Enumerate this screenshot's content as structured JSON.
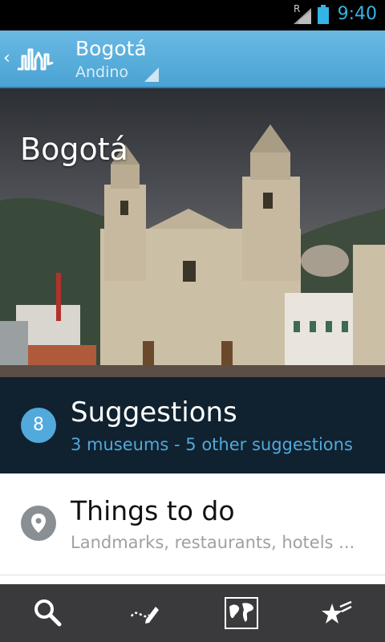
{
  "status_bar": {
    "time": "9:40",
    "network_letter": "R"
  },
  "action_bar": {
    "title": "Bogotá",
    "subtitle": "Andino"
  },
  "hero": {
    "title": "Bogotá"
  },
  "suggestions": {
    "count": "8",
    "title": "Suggestions",
    "subtitle": "3 museums - 5 other suggestions"
  },
  "things_to_do": {
    "title": "Things to do",
    "subtitle": "Landmarks, restaurants, hotels ..."
  },
  "bottom_tabs": [
    {
      "icon": "search-icon"
    },
    {
      "icon": "route-pencil-icon"
    },
    {
      "icon": "map-icon"
    },
    {
      "icon": "stars-icon"
    }
  ],
  "colors": {
    "accent": "#52a9db",
    "action_bar": "#5aaedc",
    "dark_panel": "#10212f"
  }
}
